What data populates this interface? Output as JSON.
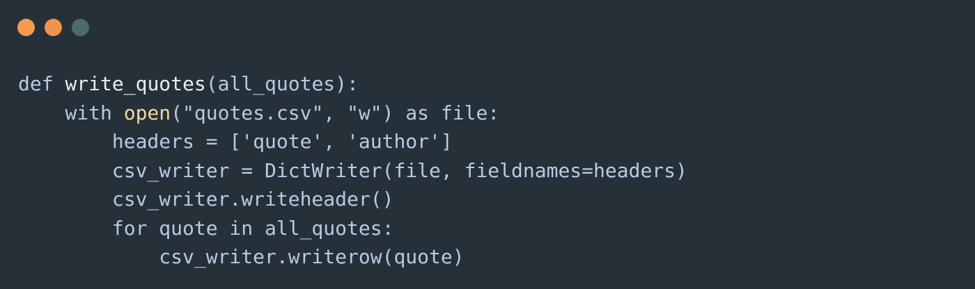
{
  "colors": {
    "background": "#263039",
    "window_close": "#f79a4b",
    "window_minimize": "#f2924b",
    "window_maximize": "#4b6b6a",
    "code_default": "#b9cbe3",
    "code_bright": "#e8eef6",
    "code_builtin": "#f0d7a8"
  },
  "window_controls": [
    {
      "name": "close-button",
      "color": "#f79a4b"
    },
    {
      "name": "minimize-button",
      "color": "#f2924b"
    },
    {
      "name": "maximize-button",
      "color": "#4b6b6a"
    }
  ],
  "code": {
    "language": "python",
    "lines": [
      [
        {
          "t": "def ",
          "c": "code_default"
        },
        {
          "t": "write_quotes",
          "c": "code_bright"
        },
        {
          "t": "(all_quotes):",
          "c": "code_default"
        }
      ],
      [
        {
          "t": "    with ",
          "c": "code_default"
        },
        {
          "t": "open",
          "c": "code_builtin"
        },
        {
          "t": "(\"quotes.csv\", \"w\") as file:",
          "c": "code_default"
        }
      ],
      [
        {
          "t": "        headers = ['quote', 'author']",
          "c": "code_default"
        }
      ],
      [
        {
          "t": "        csv_writer = DictWriter(file, fieldnames=headers)",
          "c": "code_default"
        }
      ],
      [
        {
          "t": "        csv_writer.writeheader()",
          "c": "code_default"
        }
      ],
      [
        {
          "t": "        for quote in all_quotes:",
          "c": "code_default"
        }
      ],
      [
        {
          "t": "            csv_writer.writerow(quote)",
          "c": "code_default"
        }
      ]
    ]
  }
}
